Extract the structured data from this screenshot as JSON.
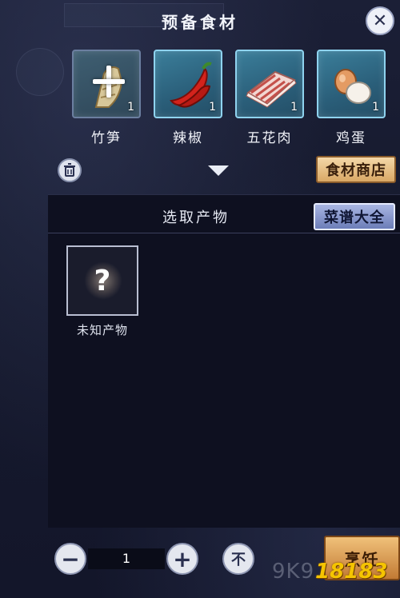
{
  "dialog": {
    "title": "预备食材",
    "close_icon": "close-x-icon"
  },
  "ingredients": [
    {
      "name": "竹笋",
      "count": "1",
      "icon": "bamboo-shoot-icon",
      "empty": true
    },
    {
      "name": "辣椒",
      "count": "1",
      "icon": "chili-pepper-icon"
    },
    {
      "name": "五花肉",
      "count": "1",
      "icon": "pork-belly-icon"
    },
    {
      "name": "鸡蛋",
      "count": "1",
      "icon": "egg-icon"
    }
  ],
  "toolbar": {
    "trash_icon": "trash-icon",
    "expand_icon": "chevron-down-icon",
    "shop_label": "食材商店"
  },
  "product_panel": {
    "title": "选取产物",
    "recipe_label": "菜谱大全",
    "product": {
      "name": "未知产物",
      "symbol": "?"
    }
  },
  "quantity": {
    "value": "1",
    "minus_symbol": "−",
    "plus_symbol": "+",
    "max_symbol": "不"
  },
  "cook": {
    "label": "烹饪"
  },
  "watermark": {
    "text": "9K9",
    "logo": "18183"
  },
  "colors": {
    "slot_border": "#8fd3ef",
    "shop_button": "#d9a865",
    "recipe_button": "#6c7db8",
    "panel_bg": "#0e1020"
  }
}
